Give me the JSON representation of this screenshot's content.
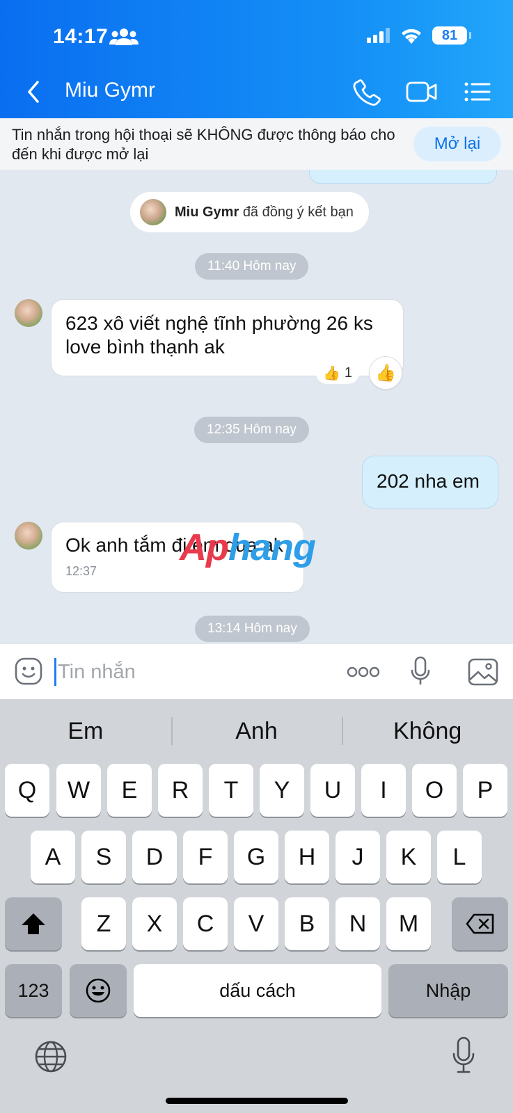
{
  "status_bar": {
    "time": "14:17",
    "battery": "81"
  },
  "header": {
    "title": "Miu Gymr"
  },
  "notice": {
    "text": "Tin nhắn trong hội thoại sẽ KHÔNG được thông báo cho đến khi được mở lại",
    "button": "Mở lại"
  },
  "chat": {
    "system_message": {
      "name": "Miu Gymr",
      "text": "đã đồng ý kết bạn"
    },
    "time_dividers": [
      "11:40 Hôm nay",
      "12:35 Hôm nay",
      "13:14 Hôm nay"
    ],
    "messages": [
      {
        "side": "in",
        "text": "623 xô viết nghệ tĩnh phường 26 ks love bình thạnh ak",
        "reaction_count": "1"
      },
      {
        "side": "out",
        "text": "202 nha em"
      },
      {
        "side": "in",
        "text": "Ok anh tắm đi em qua ak",
        "time": "12:37"
      }
    ],
    "watermark": {
      "part1": "Ap",
      "part2": "hang"
    }
  },
  "input": {
    "placeholder": "Tin nhắn"
  },
  "keyboard": {
    "suggestions": [
      "Em",
      "Anh",
      "Không"
    ],
    "row1": [
      "Q",
      "W",
      "E",
      "R",
      "T",
      "Y",
      "U",
      "I",
      "O",
      "P"
    ],
    "row2": [
      "A",
      "S",
      "D",
      "F",
      "G",
      "H",
      "J",
      "K",
      "L"
    ],
    "row3": [
      "Z",
      "X",
      "C",
      "V",
      "B",
      "N",
      "M"
    ],
    "numbers_key": "123",
    "space_key": "dấu cách",
    "return_key": "Nhập"
  },
  "colors": {
    "header_blue": "#0a6ef0",
    "accent": "#1a7ff4",
    "bubble_out": "#d5effd"
  }
}
